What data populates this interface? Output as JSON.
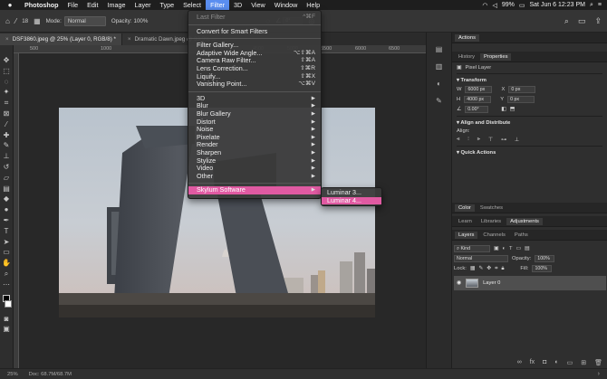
{
  "menubar": {
    "app": "Photoshop",
    "items": [
      "File",
      "Edit",
      "Image",
      "Layer",
      "Type",
      "Select",
      "Filter",
      "3D",
      "View",
      "Window",
      "Help"
    ],
    "active": "Filter",
    "datetime": "Sat Jun 6  12:23 PM",
    "battery": "99%"
  },
  "options_bar": {
    "brush_size": "18",
    "mode_label": "Mode:",
    "mode_value": "Normal",
    "opacity_label": "Opacity:",
    "opacity_value": "100%",
    "angle": "0°"
  },
  "tabs": [
    {
      "label": "DSF3860.jpeg @ 25% (Layer 0, RGB/8) *",
      "active": true
    },
    {
      "label": "Dramatic Dawn.jpeg @ 33.3% ...",
      "active": false
    }
  ],
  "ruler_top": [
    "500",
    "1000",
    "4500",
    "5000",
    "5500",
    "6000",
    "6500"
  ],
  "ruler_title_fragment": "2020",
  "filter_menu": {
    "last_filter": {
      "label": "Last Filter",
      "shortcut": "^⌘F"
    },
    "convert": "Convert for Smart Filters",
    "group1": [
      {
        "label": "Filter Gallery..."
      },
      {
        "label": "Adaptive Wide Angle...",
        "shortcut": "⌥⇧⌘A"
      },
      {
        "label": "Camera Raw Filter...",
        "shortcut": "⇧⌘A"
      },
      {
        "label": "Lens Correction...",
        "shortcut": "⇧⌘R"
      },
      {
        "label": "Liquify...",
        "shortcut": "⇧⌘X"
      },
      {
        "label": "Vanishing Point...",
        "shortcut": "⌥⌘V"
      }
    ],
    "group2": [
      "3D",
      "Blur",
      "Blur Gallery",
      "Distort",
      "Noise",
      "Pixelate",
      "Render",
      "Sharpen",
      "Stylize",
      "Video",
      "Other"
    ],
    "plugin": "Skylum Software"
  },
  "submenu": [
    "Luminar 3...",
    "Luminar 4..."
  ],
  "panels": {
    "top_tab": "Actions",
    "props_tabs": [
      "History",
      "Properties"
    ],
    "pixel_layer": "Pixel Layer",
    "transform_title": "Transform",
    "w_label": "W",
    "w_value": "6000 px",
    "h_label": "H",
    "h_value": "4000 px",
    "x_label": "X",
    "x_value": "0 px",
    "y_label": "Y",
    "y_value": "0 px",
    "angle_value": "0.00°",
    "align_title": "Align and Distribute",
    "align_label": "Align:",
    "quick_actions": "Quick Actions",
    "color_tabs": [
      "Color",
      "Swatches"
    ],
    "learn_tabs": [
      "Learn",
      "Libraries",
      "Adjustments"
    ],
    "layers_tabs": [
      "Layers",
      "Channels",
      "Paths"
    ],
    "kind": "Kind",
    "blend": "Normal",
    "opacity_label": "Opacity:",
    "opacity_value": "100%",
    "lock_label": "Lock:",
    "fill_label": "Fill:",
    "fill_value": "100%",
    "layer_name": "Layer 0"
  },
  "status": {
    "zoom": "25%",
    "doc": "Doc: 68.7M/68.7M"
  }
}
